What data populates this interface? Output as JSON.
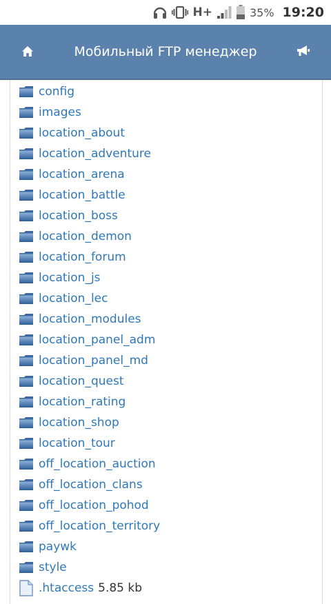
{
  "status_bar": {
    "icons": [
      "headphones-icon",
      "vibrate-icon",
      "signal-icon",
      "battery-icon"
    ],
    "network": "H+",
    "battery": "35%",
    "time": "19:20"
  },
  "header": {
    "title": "Мобильный FTP менеджер",
    "color": "#5b82ad",
    "left_icon": "home-icon",
    "right_icon": "megaphone-icon"
  },
  "folders": [
    {
      "name": "config"
    },
    {
      "name": "images"
    },
    {
      "name": "location_about"
    },
    {
      "name": "location_adventure"
    },
    {
      "name": "location_arena"
    },
    {
      "name": "location_battle"
    },
    {
      "name": "location_boss"
    },
    {
      "name": "location_demon"
    },
    {
      "name": "location_forum"
    },
    {
      "name": "location_js"
    },
    {
      "name": "location_lec"
    },
    {
      "name": "location_modules"
    },
    {
      "name": "location_panel_adm"
    },
    {
      "name": "location_panel_md"
    },
    {
      "name": "location_quest"
    },
    {
      "name": "location_rating"
    },
    {
      "name": "location_shop"
    },
    {
      "name": "location_tour"
    },
    {
      "name": "off_location_auction"
    },
    {
      "name": "off_location_clans"
    },
    {
      "name": "off_location_pohod"
    },
    {
      "name": "off_location_territory"
    },
    {
      "name": "paywk"
    },
    {
      "name": "style"
    }
  ],
  "files": [
    {
      "name": ".htaccess",
      "size": "5.85 kb"
    }
  ],
  "link_color": "#2f78b8"
}
